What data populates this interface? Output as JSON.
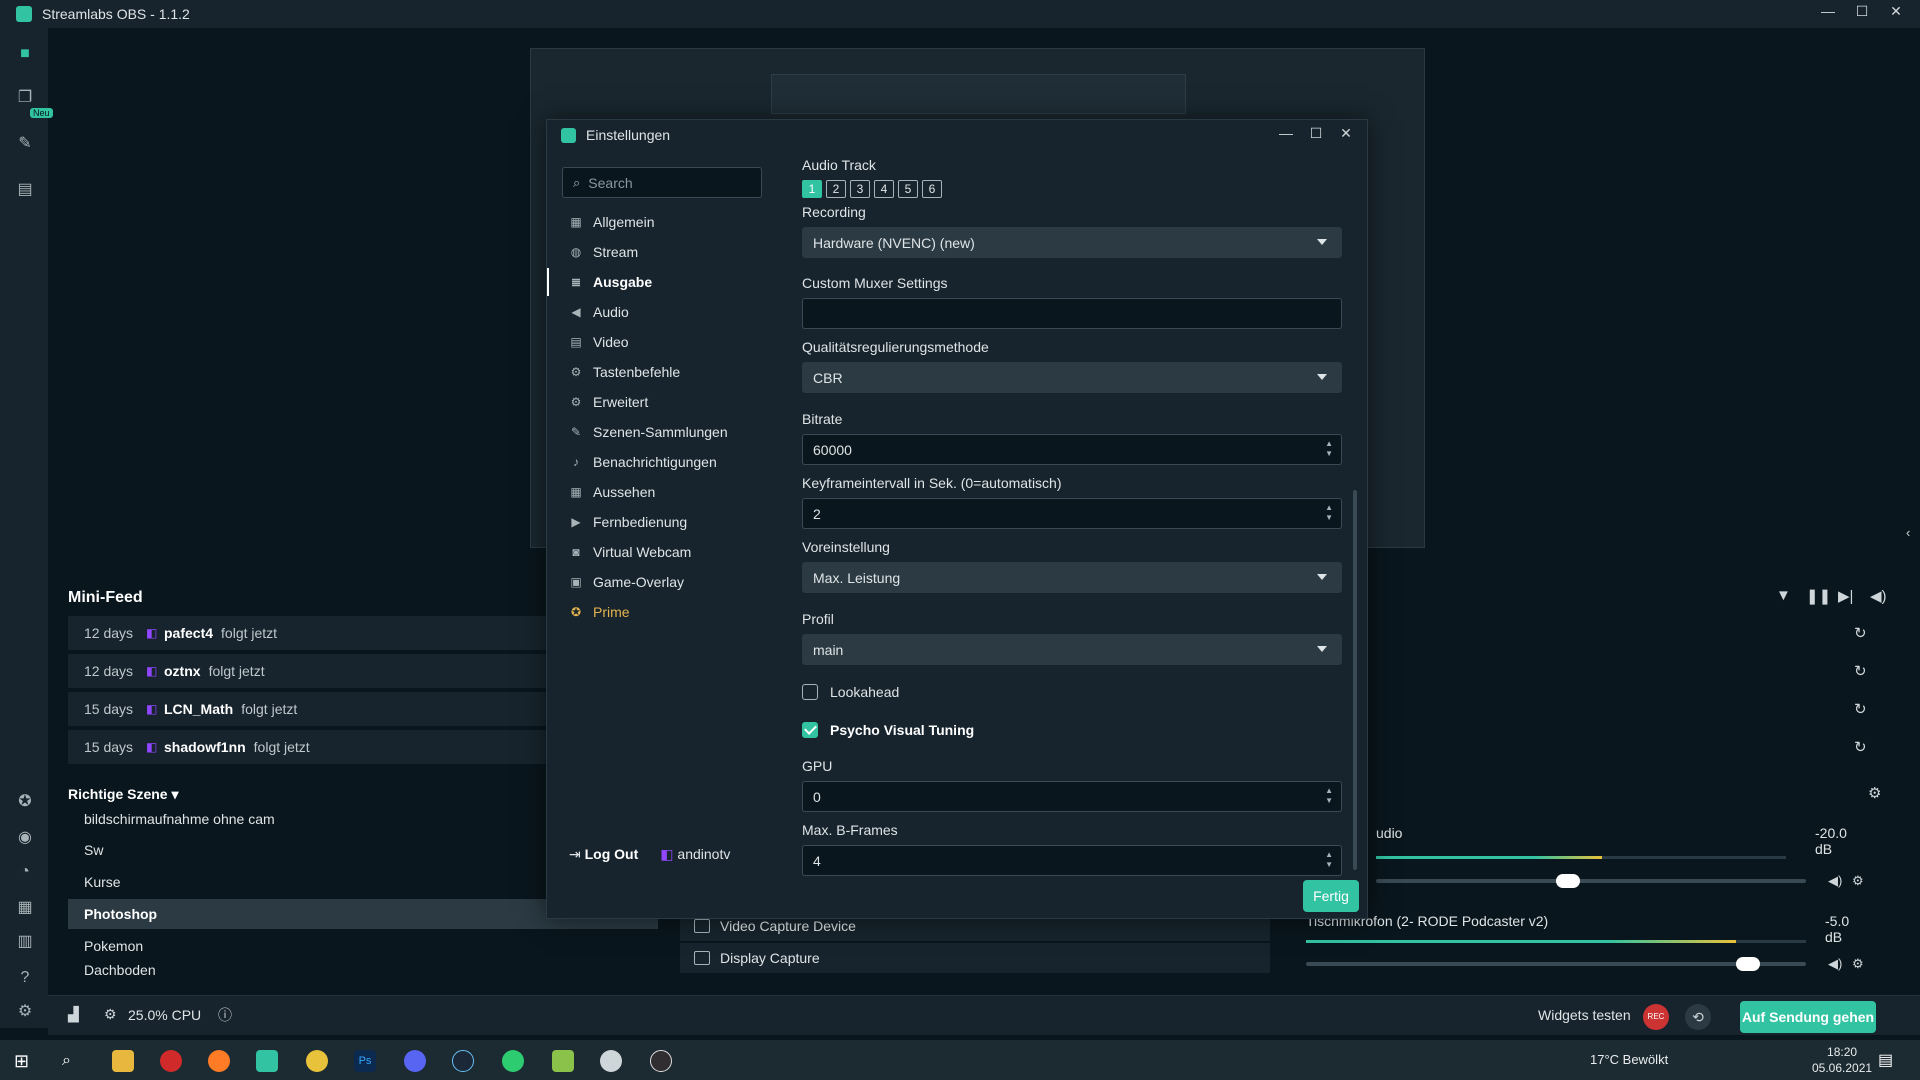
{
  "window": {
    "title": "Streamlabs OBS - 1.1.2",
    "controls": [
      "—",
      "☐",
      "✕"
    ]
  },
  "appnav": {
    "new_badge": "Neu"
  },
  "minifeed": {
    "title": "Mini-Feed",
    "items": [
      {
        "days": "12 days",
        "user": "pafect4",
        "action": "folgt jetzt"
      },
      {
        "days": "12 days",
        "user": "oztnx",
        "action": "folgt jetzt"
      },
      {
        "days": "15 days",
        "user": "LCN_Math",
        "action": "folgt jetzt"
      },
      {
        "days": "15 days",
        "user": "shadowf1nn",
        "action": "folgt jetzt"
      }
    ]
  },
  "scenes": {
    "title": "Richtige Szene",
    "items": [
      {
        "label": "bildschirmaufnahme ohne cam",
        "selected": false
      },
      {
        "label": "Sw",
        "selected": false
      },
      {
        "label": "Kurse",
        "selected": false
      },
      {
        "label": "Photoshop",
        "selected": true
      },
      {
        "label": "Pokemon",
        "selected": false
      },
      {
        "label": "Dachboden",
        "selected": false
      }
    ]
  },
  "sources": {
    "items": [
      {
        "label": "Video Capture Device"
      },
      {
        "label": "Display Capture"
      }
    ]
  },
  "mixer": {
    "items": [
      {
        "label": "udio",
        "db": "-20.0 dB",
        "level": 0.55
      },
      {
        "label": "Tischmikrofon (2- RODE Podcaster v2)",
        "db": "-5.0 dB",
        "level": 0.86
      }
    ]
  },
  "footer": {
    "cpu": "25.0% CPU",
    "widgets_label": "Widgets testen",
    "rec_label": "REC",
    "golive_label": "Auf Sendung gehen"
  },
  "taskbar": {
    "weather": "17°C  Bewölkt",
    "time": "18:20",
    "date": "05.06.2021"
  },
  "settings": {
    "title": "Einstellungen",
    "search_placeholder": "Search",
    "nav": [
      {
        "label": "Allgemein",
        "icon": "grid-icon"
      },
      {
        "label": "Stream",
        "icon": "globe-icon"
      },
      {
        "label": "Ausgabe",
        "icon": "database-icon",
        "active": true
      },
      {
        "label": "Audio",
        "icon": "speaker-icon"
      },
      {
        "label": "Video",
        "icon": "film-icon"
      },
      {
        "label": "Tastenbefehle",
        "icon": "cog-icon"
      },
      {
        "label": "Erweitert",
        "icon": "cogs-icon"
      },
      {
        "label": "Szenen-Sammlungen",
        "icon": "tools-icon"
      },
      {
        "label": "Benachrichtigungen",
        "icon": "bell-icon"
      },
      {
        "label": "Aussehen",
        "icon": "grid-icon"
      },
      {
        "label": "Fernbedienung",
        "icon": "play-icon"
      },
      {
        "label": "Virtual Webcam",
        "icon": "camera-icon"
      },
      {
        "label": "Game-Overlay",
        "icon": "overlay-icon"
      },
      {
        "label": "Prime",
        "icon": "prime-icon",
        "prime": true
      }
    ],
    "logout_label": "Log Out",
    "account": "andinotv",
    "done_label": "Fertig",
    "audio_track_label": "Audio Track",
    "tracks": [
      "1",
      "2",
      "3",
      "4",
      "5",
      "6"
    ],
    "active_track": "1",
    "recording_label": "Recording",
    "recording_value": "Hardware (NVENC) (new)",
    "muxer_label": "Custom Muxer Settings",
    "muxer_value": "",
    "rate_label": "Qualitätsregulierungsmethode",
    "rate_value": "CBR",
    "bitrate_label": "Bitrate",
    "bitrate_value": "60000",
    "keyframe_label": "Keyframeintervall in Sek. (0=automatisch)",
    "keyframe_value": "2",
    "preset_label": "Voreinstellung",
    "preset_value": "Max. Leistung",
    "profile_label": "Profil",
    "profile_value": "main",
    "lookahead_label": "Lookahead",
    "lookahead_checked": false,
    "psycho_label": "Psycho Visual Tuning",
    "psycho_checked": true,
    "gpu_label": "GPU",
    "gpu_value": "0",
    "bframes_label": "Max. B-Frames",
    "bframes_value": "4"
  },
  "colors": {
    "accent": "#31c3a2",
    "background": "#09161d",
    "panel": "#17242d",
    "prime": "#e3b34d",
    "twitch": "#9146ff"
  }
}
